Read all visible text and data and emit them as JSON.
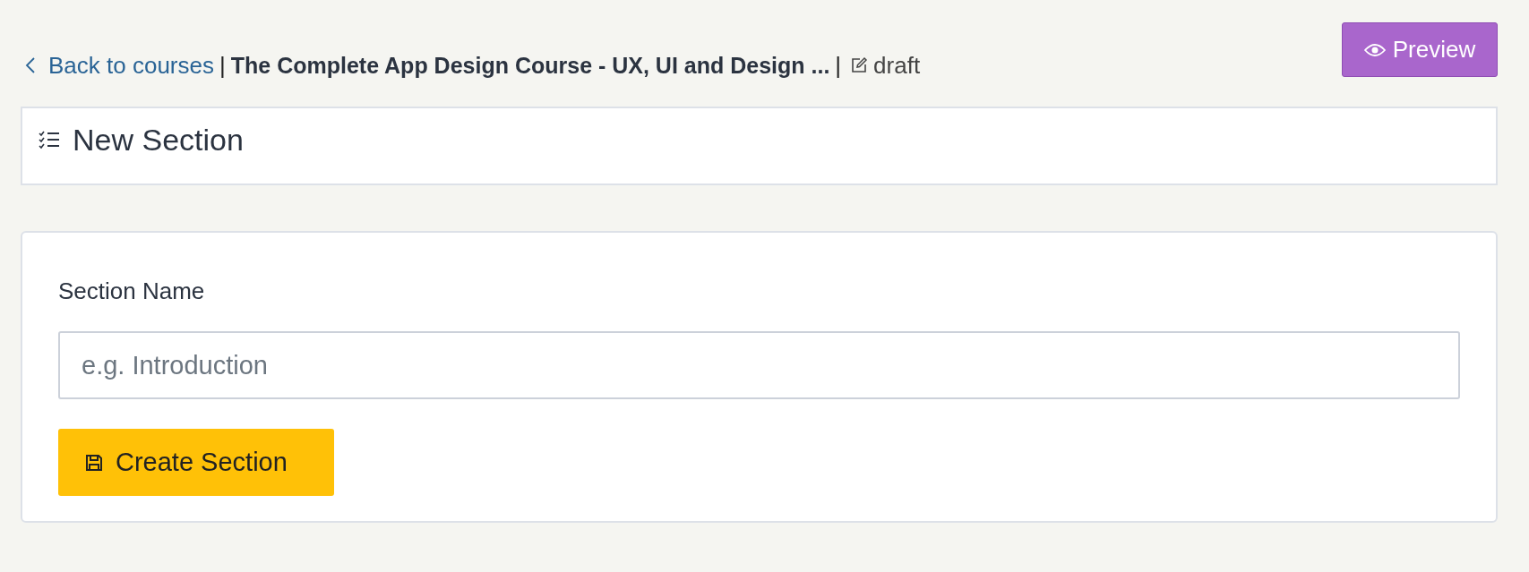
{
  "header": {
    "back_link": "Back to courses",
    "separator_1": "|",
    "course_title": "The Complete App Design Course - UX, UI and Design ...",
    "separator_2": "|",
    "status": "draft",
    "preview_button": "Preview"
  },
  "section_header": {
    "title": "New Section"
  },
  "form": {
    "label": "Section Name",
    "placeholder": "e.g. Introduction",
    "submit_button": "Create Section"
  }
}
